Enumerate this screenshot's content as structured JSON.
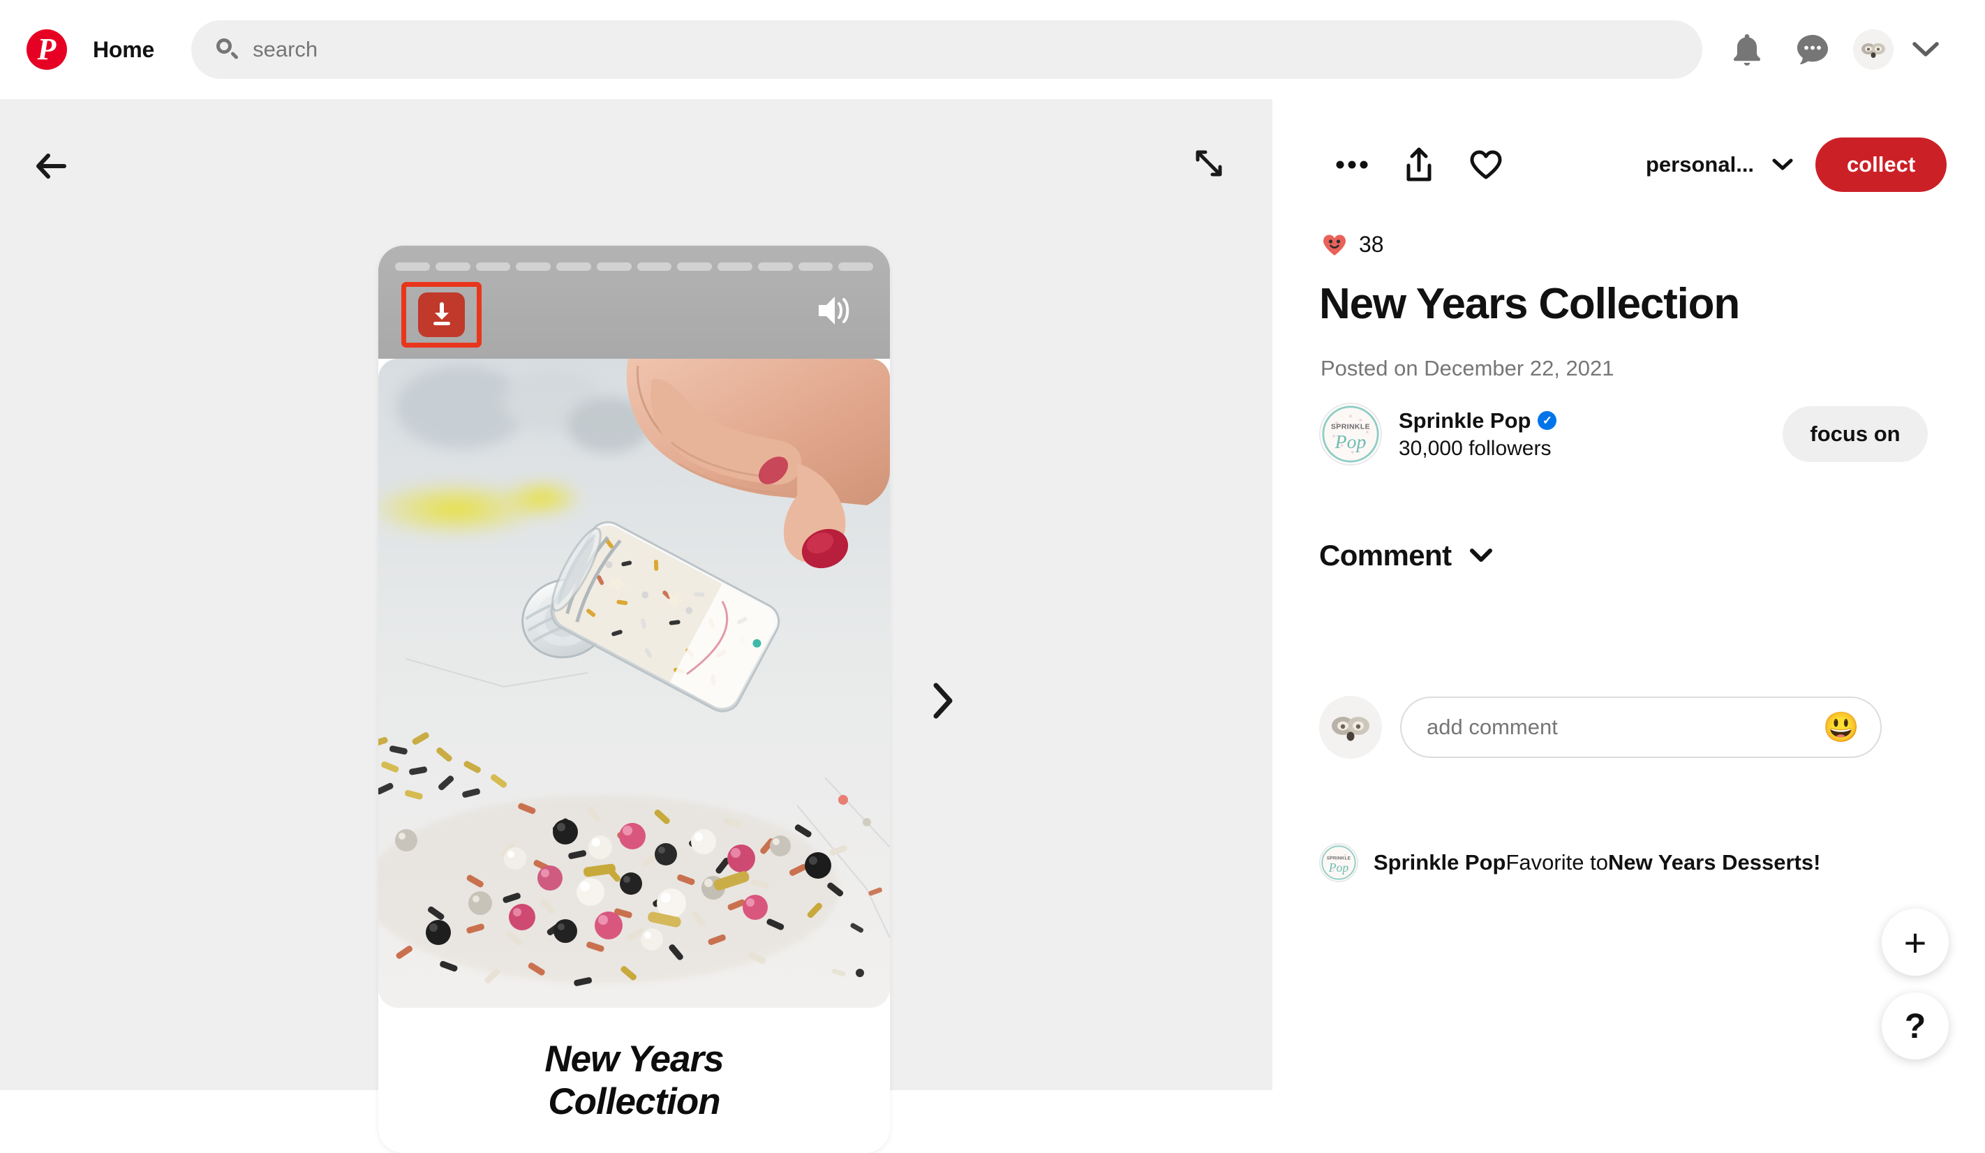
{
  "header": {
    "logo_icon": "pinterest-logo-icon",
    "logo_glyph": "P",
    "home_label": "Home",
    "search": {
      "placeholder": "search",
      "value": "",
      "icon": "search-icon"
    },
    "icons": [
      {
        "name": "notifications-icon",
        "label": "notifications"
      },
      {
        "name": "messages-icon",
        "label": "messages"
      },
      {
        "name": "account-avatar",
        "label": "account"
      },
      {
        "name": "chevron-down-icon",
        "label": "account menu"
      }
    ]
  },
  "content": {
    "back_icon": "back-arrow-icon",
    "expand_icon": "expand-icon",
    "next_icon": "chevron-right-icon",
    "card": {
      "progress_segments": 12,
      "download_icon": "download-icon",
      "download_highlighted": true,
      "highlight_color": "#e8361c",
      "download_button_color": "#c0392b",
      "volume_icon": "volume-on-icon",
      "caption_line1": "New Years",
      "caption_line2": "Collection",
      "image_alt": "hand pouring sprinkles from a jar onto marble"
    }
  },
  "detail": {
    "actions": {
      "more_icon": "more-options-icon",
      "share_icon": "share-icon",
      "heart_icon": "heart-outline-icon",
      "board_name": "personal...",
      "board_caret_icon": "chevron-down-icon",
      "collect_label": "collect",
      "collect_color": "#cc2027"
    },
    "reaction": {
      "emoji": "❤️",
      "emoji_name": "smiling-heart-icon",
      "count": "38"
    },
    "title": "New Years Collection",
    "posted": "Posted on December 22, 2021",
    "author": {
      "avatar_name": "sprinkle-pop-avatar",
      "avatar_line1": "SPRINKLE",
      "avatar_line2": "Pop",
      "name": "Sprinkle Pop",
      "verified_icon": "verified-badge-icon",
      "verified_glyph": "✓",
      "followers": "30,000 followers",
      "follow_label": "focus on"
    },
    "comments": {
      "section_label": "Comment",
      "section_caret_icon": "chevron-down-icon",
      "input_placeholder": "add comment",
      "input_value": "",
      "emoji_button": "😃",
      "emoji_button_name": "emoji-picker-icon",
      "commenter_avatar_name": "user-avatar",
      "list": [
        {
          "avatar_name": "sprinkle-pop-avatar",
          "author": "Sprinkle Pop",
          "action": "Favorite to",
          "target": "New Years Desserts!"
        }
      ]
    }
  },
  "floating": {
    "add_label": "+",
    "add_icon": "plus-icon",
    "help_label": "?",
    "help_icon": "help-icon"
  }
}
